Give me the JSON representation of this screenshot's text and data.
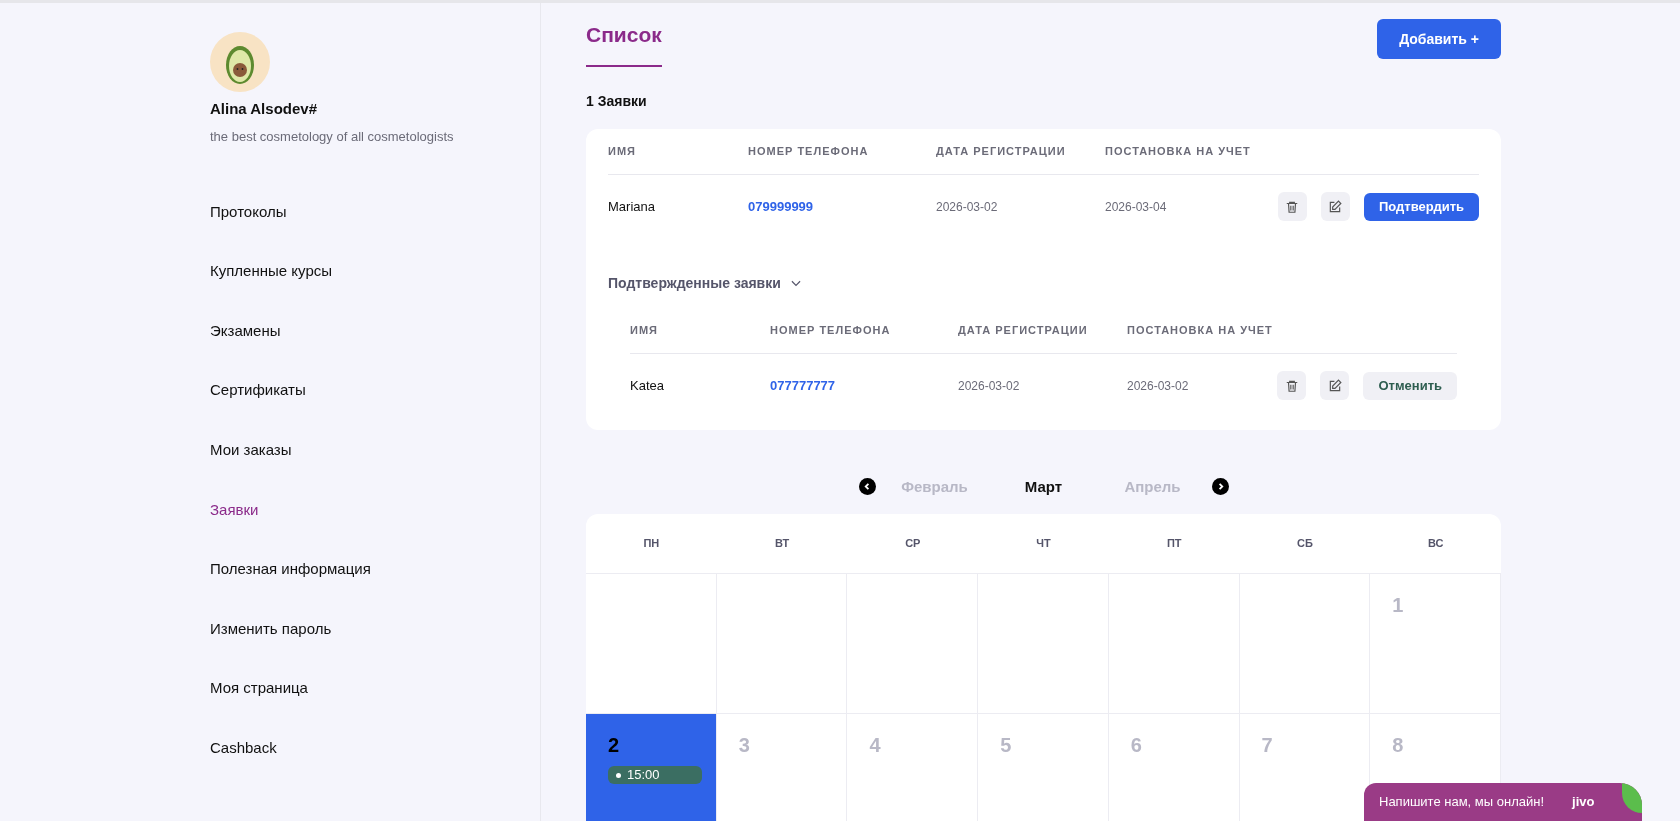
{
  "sidebar": {
    "profile": {
      "name": "Alina Alsodev#",
      "tagline": "the best cosmetology of all cosmetologists"
    },
    "items": [
      {
        "label": "Протоколы",
        "selected": false
      },
      {
        "label": "Купленные курсы",
        "selected": false
      },
      {
        "label": "Экзамены",
        "selected": false
      },
      {
        "label": "Сертификаты",
        "selected": false
      },
      {
        "label": "Мои заказы",
        "selected": false
      },
      {
        "label": "Заявки",
        "selected": true
      },
      {
        "label": "Полезная информация",
        "selected": false
      },
      {
        "label": "Изменить пароль",
        "selected": false
      },
      {
        "label": "Моя страница",
        "selected": false
      },
      {
        "label": "Cashback",
        "selected": false
      }
    ]
  },
  "header": {
    "title": "Список",
    "add_button": "Добавить +"
  },
  "count": "1 Заявки",
  "pending": {
    "columns": [
      "ИМЯ",
      "НОМЕР ТЕЛЕФОНА",
      "ДАТА РЕГИСТРАЦИИ",
      "ПОСТАНОВКА НА УЧЕТ"
    ],
    "rows": [
      {
        "name": "Mariana",
        "phone": "079999999",
        "registered": "2026-03-02",
        "enrolled": "2026-03-04",
        "action": {
          "kind": "confirm",
          "label": "Подтвердить"
        }
      }
    ]
  },
  "confirmed": {
    "title": "Подтвержденные заявки",
    "expanded": true,
    "columns": [
      "ИМЯ",
      "НОМЕР ТЕЛЕФОНА",
      "ДАТА РЕГИСТРАЦИИ",
      "ПОСТАНОВКА НА УЧЕТ"
    ],
    "rows": [
      {
        "name": "Katea",
        "phone": "077777777",
        "registered": "2026-03-02",
        "enrolled": "2026-03-02",
        "action": {
          "kind": "cancel",
          "label": "Отменить"
        }
      }
    ]
  },
  "calendar": {
    "months": [
      {
        "label": "Февраль",
        "selected": false
      },
      {
        "label": "Март",
        "selected": true
      },
      {
        "label": "Апрель",
        "selected": false
      }
    ],
    "weekdays": [
      "ПН",
      "ВТ",
      "СР",
      "ЧТ",
      "ПТ",
      "СБ",
      "ВС"
    ],
    "weeks": [
      [
        {
          "kind": "blank"
        },
        {
          "kind": "blank"
        },
        {
          "kind": "blank"
        },
        {
          "kind": "blank"
        },
        {
          "kind": "blank"
        },
        {
          "kind": "blank"
        },
        {
          "kind": "day",
          "day": "1",
          "selected": false
        }
      ],
      [
        {
          "kind": "day",
          "day": "2",
          "selected": true,
          "events": [
            {
              "time": "15:00",
              "color": "#3b6e62"
            }
          ]
        },
        {
          "kind": "day",
          "day": "3",
          "selected": false
        },
        {
          "kind": "day",
          "day": "4",
          "selected": false
        },
        {
          "kind": "day",
          "day": "5",
          "selected": false
        },
        {
          "kind": "day",
          "day": "6",
          "selected": false
        },
        {
          "kind": "day",
          "day": "7",
          "selected": false
        },
        {
          "kind": "day",
          "day": "8",
          "selected": false
        }
      ]
    ]
  },
  "chat": {
    "label": "Напишите нам, мы онлайн!",
    "brand": "jivo"
  }
}
